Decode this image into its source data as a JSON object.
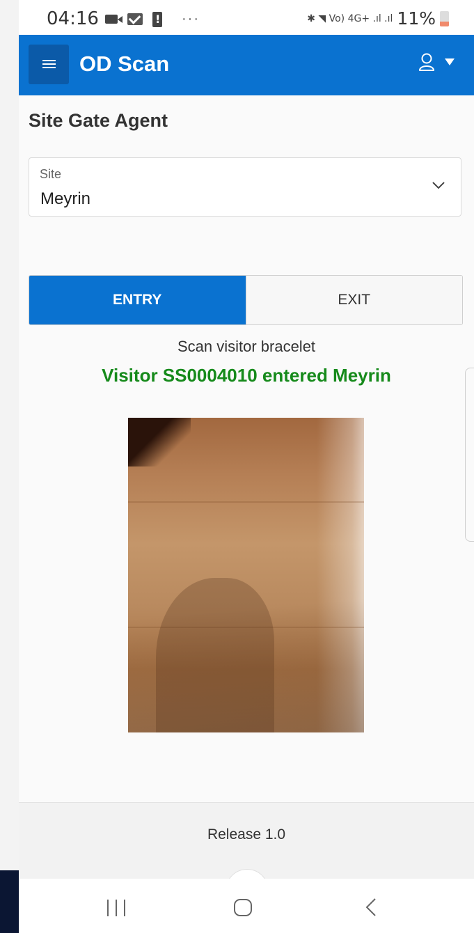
{
  "status_bar": {
    "time": "04:16",
    "signal_text": "✱ ◥ Vo) 4G+ .ıl .ıl",
    "battery_percent": "11%"
  },
  "app_bar": {
    "title": "OD Scan"
  },
  "page": {
    "title": "Site Gate Agent",
    "site_select": {
      "label": "Site",
      "value": "Meyrin"
    },
    "mode_toggle": {
      "entry_label": "ENTRY",
      "exit_label": "EXIT",
      "selected": "ENTRY"
    },
    "scan_hint": "Scan visitor bracelet",
    "scan_result": "Visitor SS0004010 entered Meyrin"
  },
  "footer": {
    "release": "Release 1.0"
  },
  "colors": {
    "primary": "#0a72d0",
    "success": "#168a1b"
  },
  "icons": {
    "menu": "hamburger-icon",
    "user": "user-icon",
    "dropdown": "chevron-down-icon",
    "nav_recents": "recents-icon",
    "nav_home": "home-icon",
    "nav_back": "back-icon"
  }
}
